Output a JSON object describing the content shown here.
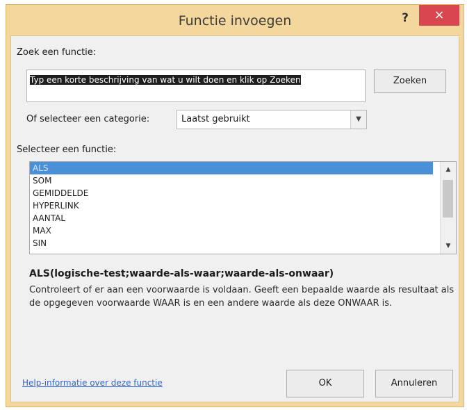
{
  "dialog": {
    "title": "Functie invoegen",
    "help_label": "?",
    "close_label": "×"
  },
  "search": {
    "label": "Zoek een functie:",
    "value": "Typ een korte beschrijving van wat u wilt doen en klik op Zoeken",
    "button_label": "Zoeken"
  },
  "category": {
    "label": "Of selecteer een categorie:",
    "selected": "Laatst gebruikt"
  },
  "functions": {
    "label": "Selecteer een functie:",
    "items": [
      "ALS",
      "SOM",
      "GEMIDDELDE",
      "HYPERLINK",
      "AANTAL",
      "MAX",
      "SIN"
    ],
    "selected_index": 0
  },
  "details": {
    "signature": "ALS(logische-test;waarde-als-waar;waarde-als-onwaar)",
    "description": "Controleert of er aan een voorwaarde is voldaan. Geeft een bepaalde waarde als resultaat als de opgegeven voorwaarde WAAR is en een andere waarde als deze ONWAAR is."
  },
  "footer": {
    "help_link": "Help-informatie over deze functie",
    "ok_label": "OK",
    "cancel_label": "Annuleren"
  },
  "colors": {
    "frame": "#f3d79c",
    "close": "#d9464f",
    "selection": "#4a90d9"
  }
}
